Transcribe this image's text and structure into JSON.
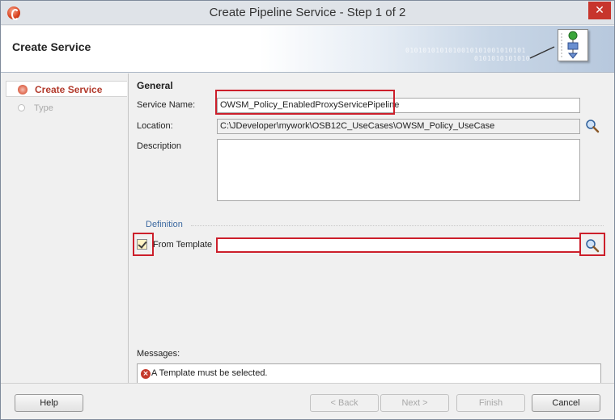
{
  "window": {
    "title": "Create Pipeline Service - Step 1 of 2",
    "close_glyph": "✕"
  },
  "header": {
    "title": "Create Service",
    "binary_line1": "0101010101010010101001010101",
    "binary_line2": "0101010101010"
  },
  "steps": [
    {
      "label": "Create Service",
      "state": "current"
    },
    {
      "label": "Type",
      "state": "pending"
    }
  ],
  "form": {
    "section_title": "General",
    "service_name_label": "Service Name:",
    "service_name_value": "OWSM_Policy_EnabledProxyServicePipeline",
    "location_label": "Location:",
    "location_value": "C:\\JDeveloper\\mywork\\OSB12C_UseCases\\OWSM_Policy_UseCase",
    "description_label": "Description",
    "description_value": "",
    "definition_title": "Definition",
    "from_template_label": "From Template",
    "from_template_checked": true,
    "template_value": "",
    "messages_label": "Messages:",
    "message_text": "A Template must be selected."
  },
  "buttons": {
    "help": "Help",
    "back": "< Back",
    "next": "Next >",
    "finish": "Finish",
    "cancel": "Cancel"
  },
  "colors": {
    "highlight_red": "#cc1f2b",
    "step_active_text": "#b23a2c",
    "definition_text": "#3d6aa1"
  },
  "icons": [
    "app-icon",
    "close-icon",
    "pipeline-wizard-icon",
    "step-current-icon",
    "step-pending-icon",
    "search-icon",
    "error-icon"
  ]
}
